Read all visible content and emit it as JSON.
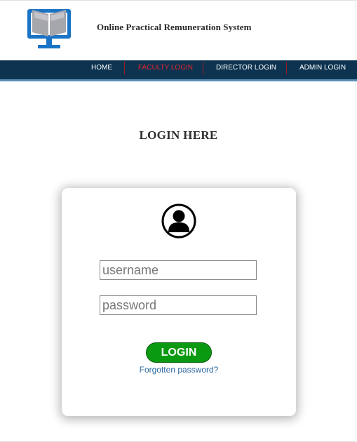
{
  "header": {
    "site_title": "Online Practical Remuneration System",
    "logo_icon": "book-monitor-icon"
  },
  "nav": {
    "items": [
      {
        "label": "HOME",
        "active": false
      },
      {
        "label": "FACULTY LOGIN",
        "active": true
      },
      {
        "label": "DIRECTOR LOGIN",
        "active": false
      },
      {
        "label": "ADMIN LOGIN",
        "active": false
      }
    ]
  },
  "main": {
    "heading": "LOGIN HERE"
  },
  "login_form": {
    "avatar_icon": "user-avatar-icon",
    "username_placeholder": "username",
    "username_value": "",
    "password_placeholder": "password",
    "password_value": "",
    "submit_label": "LOGIN",
    "forgot_label": "Forgotten password?"
  },
  "colors": {
    "navbar_bg": "#0d3350",
    "nav_active": "#e0262e",
    "login_button": "#0a9a11",
    "link": "#2e6aa0",
    "logo_blue": "#1a73c4"
  }
}
